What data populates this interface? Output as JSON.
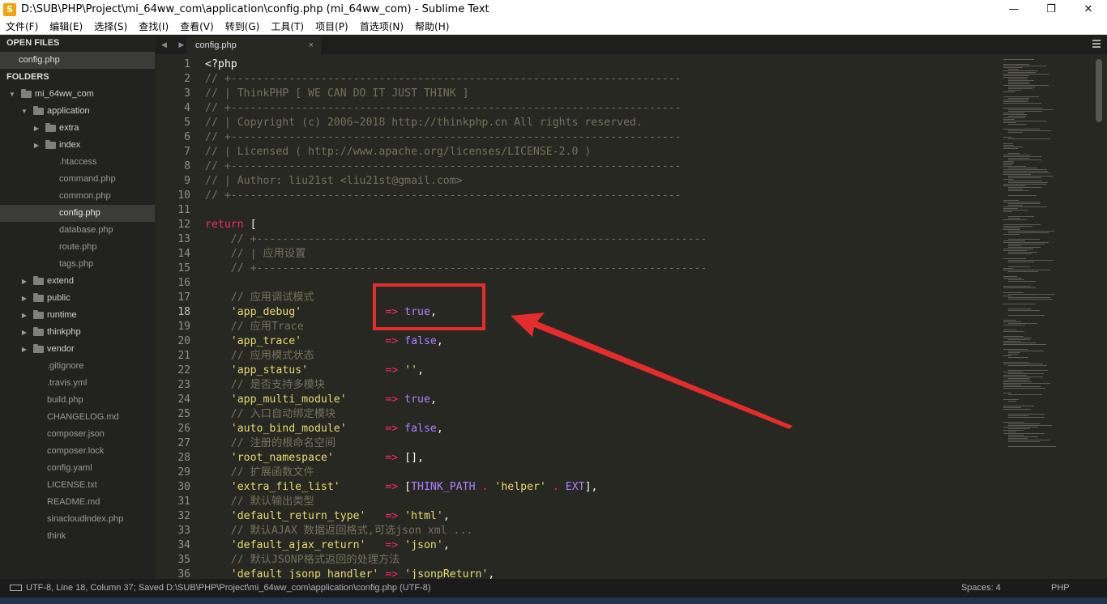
{
  "window": {
    "title": "D:\\SUB\\PHP\\Project\\mi_64ww_com\\application\\config.php (mi_64ww_com) - Sublime Text",
    "controls": [
      "—",
      "❐",
      "✕"
    ]
  },
  "menu": [
    "文件(F)",
    "编辑(E)",
    "选择(S)",
    "查找(I)",
    "查看(V)",
    "转到(G)",
    "工具(T)",
    "项目(P)",
    "首选项(N)",
    "帮助(H)"
  ],
  "sidebar": {
    "open_files_title": "OPEN FILES",
    "open_files": [
      "config.php"
    ],
    "folders_title": "FOLDERS",
    "tree": [
      {
        "label": "mi_64ww_com",
        "type": "folder",
        "depth": 0,
        "expanded": true
      },
      {
        "label": "application",
        "type": "folder",
        "depth": 1,
        "expanded": true
      },
      {
        "label": "extra",
        "type": "folder",
        "depth": 2,
        "expanded": false
      },
      {
        "label": "index",
        "type": "folder",
        "depth": 2,
        "expanded": false
      },
      {
        "label": ".htaccess",
        "type": "file",
        "depth": 2
      },
      {
        "label": "command.php",
        "type": "file",
        "depth": 2
      },
      {
        "label": "common.php",
        "type": "file",
        "depth": 2
      },
      {
        "label": "config.php",
        "type": "file",
        "depth": 2,
        "selected": true
      },
      {
        "label": "database.php",
        "type": "file",
        "depth": 2
      },
      {
        "label": "route.php",
        "type": "file",
        "depth": 2
      },
      {
        "label": "tags.php",
        "type": "file",
        "depth": 2
      },
      {
        "label": "extend",
        "type": "folder",
        "depth": 1,
        "expanded": false
      },
      {
        "label": "public",
        "type": "folder",
        "depth": 1,
        "expanded": false
      },
      {
        "label": "runtime",
        "type": "folder",
        "depth": 1,
        "expanded": false
      },
      {
        "label": "thinkphp",
        "type": "folder",
        "depth": 1,
        "expanded": false
      },
      {
        "label": "vendor",
        "type": "folder",
        "depth": 1,
        "expanded": false
      },
      {
        "label": ".gitignore",
        "type": "file",
        "depth": 1
      },
      {
        "label": ".travis.yml",
        "type": "file",
        "depth": 1
      },
      {
        "label": "build.php",
        "type": "file",
        "depth": 1
      },
      {
        "label": "CHANGELOG.md",
        "type": "file",
        "depth": 1
      },
      {
        "label": "composer.json",
        "type": "file",
        "depth": 1
      },
      {
        "label": "composer.lock",
        "type": "file",
        "depth": 1
      },
      {
        "label": "config.yaml",
        "type": "file",
        "depth": 1
      },
      {
        "label": "LICENSE.txt",
        "type": "file",
        "depth": 1
      },
      {
        "label": "README.md",
        "type": "file",
        "depth": 1
      },
      {
        "label": "sinacloudindex.php",
        "type": "file",
        "depth": 1
      },
      {
        "label": "think",
        "type": "file",
        "depth": 1
      }
    ]
  },
  "tabs": {
    "nav": "◀ ▶",
    "active": {
      "label": "config.php",
      "close": "×"
    }
  },
  "editor": {
    "current_line": 18,
    "lines": [
      {
        "n": "1",
        "t": [
          [
            "pl",
            "<?php"
          ]
        ]
      },
      {
        "n": "2",
        "t": [
          [
            "cm",
            "// +----------------------------------------------------------------------"
          ]
        ]
      },
      {
        "n": "3",
        "t": [
          [
            "cm",
            "// | ThinkPHP [ WE CAN DO IT JUST THINK ]"
          ]
        ]
      },
      {
        "n": "4",
        "t": [
          [
            "cm",
            "// +----------------------------------------------------------------------"
          ]
        ]
      },
      {
        "n": "5",
        "t": [
          [
            "cm",
            "// | Copyright (c) 2006~2018 http://thinkphp.cn All rights reserved."
          ]
        ]
      },
      {
        "n": "6",
        "t": [
          [
            "cm",
            "// +----------------------------------------------------------------------"
          ]
        ]
      },
      {
        "n": "7",
        "t": [
          [
            "cm",
            "// | Licensed ( http://www.apache.org/licenses/LICENSE-2.0 )"
          ]
        ]
      },
      {
        "n": "8",
        "t": [
          [
            "cm",
            "// +----------------------------------------------------------------------"
          ]
        ]
      },
      {
        "n": "9",
        "t": [
          [
            "cm",
            "// | Author: liu21st <liu21st@gmail.com>"
          ]
        ]
      },
      {
        "n": "10",
        "t": [
          [
            "cm",
            "// +----------------------------------------------------------------------"
          ]
        ]
      },
      {
        "n": "11",
        "t": []
      },
      {
        "n": "12",
        "t": [
          [
            "kw",
            "return"
          ],
          [
            "pl",
            " ["
          ]
        ]
      },
      {
        "n": "13",
        "t": [
          [
            "cm",
            "    // +----------------------------------------------------------------------"
          ]
        ]
      },
      {
        "n": "14",
        "t": [
          [
            "cm",
            "    // | 应用设置"
          ]
        ]
      },
      {
        "n": "15",
        "t": [
          [
            "cm",
            "    // +----------------------------------------------------------------------"
          ]
        ]
      },
      {
        "n": "16",
        "t": []
      },
      {
        "n": "17",
        "t": [
          [
            "cm",
            "    // 应用调试模式"
          ]
        ]
      },
      {
        "n": "18",
        "t": [
          [
            "pl",
            "    "
          ],
          [
            "str",
            "'app_debug'"
          ],
          [
            "pl",
            "             "
          ],
          [
            "op",
            "=>"
          ],
          [
            "pl",
            " "
          ],
          [
            "con",
            "true"
          ],
          [
            "pl",
            ","
          ]
        ]
      },
      {
        "n": "19",
        "t": [
          [
            "cm",
            "    // 应用Trace"
          ]
        ]
      },
      {
        "n": "20",
        "t": [
          [
            "pl",
            "    "
          ],
          [
            "str",
            "'app_trace'"
          ],
          [
            "pl",
            "             "
          ],
          [
            "op",
            "=>"
          ],
          [
            "pl",
            " "
          ],
          [
            "con",
            "false"
          ],
          [
            "pl",
            ","
          ]
        ]
      },
      {
        "n": "21",
        "t": [
          [
            "cm",
            "    // 应用模式状态"
          ]
        ]
      },
      {
        "n": "22",
        "t": [
          [
            "pl",
            "    "
          ],
          [
            "str",
            "'app_status'"
          ],
          [
            "pl",
            "            "
          ],
          [
            "op",
            "=>"
          ],
          [
            "pl",
            " "
          ],
          [
            "str",
            "''"
          ],
          [
            "pl",
            ","
          ]
        ]
      },
      {
        "n": "23",
        "t": [
          [
            "cm",
            "    // 是否支持多模块"
          ]
        ]
      },
      {
        "n": "24",
        "t": [
          [
            "pl",
            "    "
          ],
          [
            "str",
            "'app_multi_module'"
          ],
          [
            "pl",
            "      "
          ],
          [
            "op",
            "=>"
          ],
          [
            "pl",
            " "
          ],
          [
            "con",
            "true"
          ],
          [
            "pl",
            ","
          ]
        ]
      },
      {
        "n": "25",
        "t": [
          [
            "cm",
            "    // 入口自动绑定模块"
          ]
        ]
      },
      {
        "n": "26",
        "t": [
          [
            "pl",
            "    "
          ],
          [
            "str",
            "'auto_bind_module'"
          ],
          [
            "pl",
            "      "
          ],
          [
            "op",
            "=>"
          ],
          [
            "pl",
            " "
          ],
          [
            "con",
            "false"
          ],
          [
            "pl",
            ","
          ]
        ]
      },
      {
        "n": "27",
        "t": [
          [
            "cm",
            "    // 注册的根命名空间"
          ]
        ]
      },
      {
        "n": "28",
        "t": [
          [
            "pl",
            "    "
          ],
          [
            "str",
            "'root_namespace'"
          ],
          [
            "pl",
            "        "
          ],
          [
            "op",
            "=>"
          ],
          [
            "pl",
            " [],"
          ]
        ]
      },
      {
        "n": "29",
        "t": [
          [
            "cm",
            "    // 扩展函数文件"
          ]
        ]
      },
      {
        "n": "30",
        "t": [
          [
            "pl",
            "    "
          ],
          [
            "str",
            "'extra_file_list'"
          ],
          [
            "pl",
            "       "
          ],
          [
            "op",
            "=>"
          ],
          [
            "pl",
            " ["
          ],
          [
            "con",
            "THINK_PATH"
          ],
          [
            "pl",
            " "
          ],
          [
            "op",
            "."
          ],
          [
            "pl",
            " "
          ],
          [
            "str",
            "'helper'"
          ],
          [
            "pl",
            " "
          ],
          [
            "op",
            "."
          ],
          [
            "pl",
            " "
          ],
          [
            "con",
            "EXT"
          ],
          [
            "pl",
            "],"
          ]
        ]
      },
      {
        "n": "31",
        "t": [
          [
            "cm",
            "    // 默认输出类型"
          ]
        ]
      },
      {
        "n": "32",
        "t": [
          [
            "pl",
            "    "
          ],
          [
            "str",
            "'default_return_type'"
          ],
          [
            "pl",
            "   "
          ],
          [
            "op",
            "=>"
          ],
          [
            "pl",
            " "
          ],
          [
            "str",
            "'html'"
          ],
          [
            "pl",
            ","
          ]
        ]
      },
      {
        "n": "33",
        "t": [
          [
            "cm",
            "    // 默认AJAX 数据返回格式,可选json xml ..."
          ]
        ]
      },
      {
        "n": "34",
        "t": [
          [
            "pl",
            "    "
          ],
          [
            "str",
            "'default_ajax_return'"
          ],
          [
            "pl",
            "   "
          ],
          [
            "op",
            "=>"
          ],
          [
            "pl",
            " "
          ],
          [
            "str",
            "'json'"
          ],
          [
            "pl",
            ","
          ]
        ]
      },
      {
        "n": "35",
        "t": [
          [
            "cm",
            "    // 默认JSONP格式返回的处理方法"
          ]
        ]
      },
      {
        "n": "36",
        "t": [
          [
            "pl",
            "    "
          ],
          [
            "str",
            "'default_jsonp_handler'"
          ],
          [
            "pl",
            " "
          ],
          [
            "op",
            "=>"
          ],
          [
            "pl",
            " "
          ],
          [
            "str",
            "'jsonpReturn'"
          ],
          [
            "pl",
            ","
          ]
        ]
      }
    ]
  },
  "status": {
    "text": "UTF-8, Line 18, Column 37; Saved D:\\SUB\\PHP\\Project\\mi_64ww_com\\application\\config.php (UTF-8)",
    "spaces": "Spaces: 4",
    "syntax": "PHP"
  },
  "colors": {
    "background": "#272822",
    "comment": "#75715e",
    "keyword": "#f92672",
    "string": "#e6db74",
    "constant": "#ae81ff",
    "annotation": "#e32c2c"
  }
}
